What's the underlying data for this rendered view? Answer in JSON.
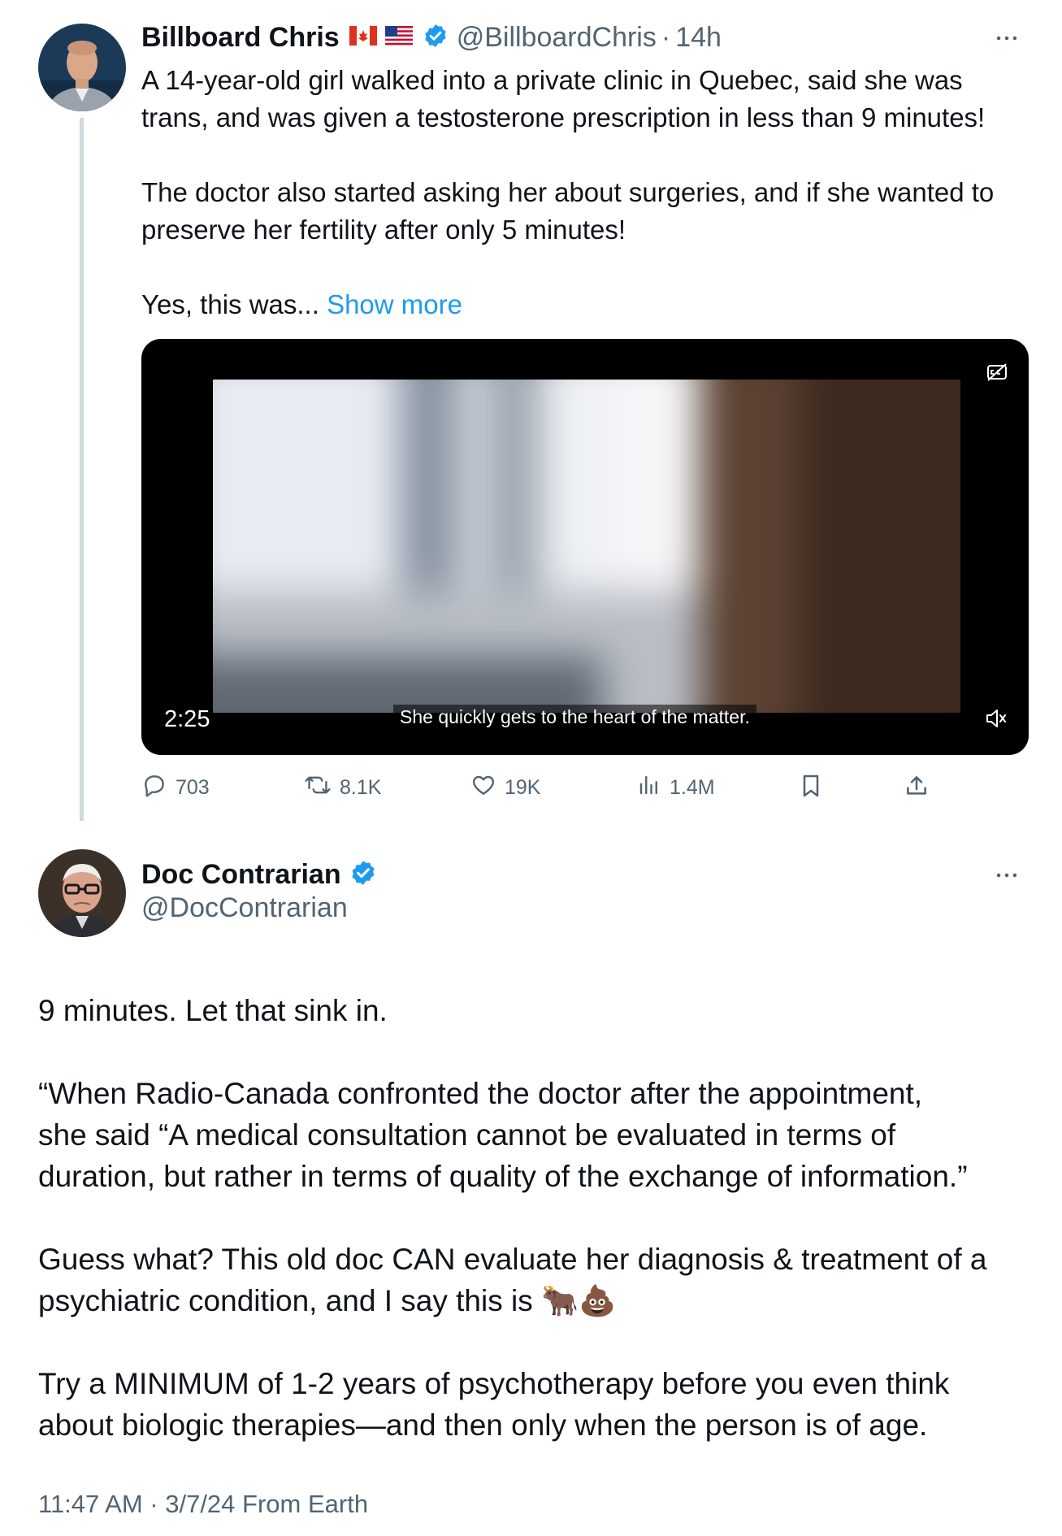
{
  "tweet1": {
    "author_name": "Billboard Chris",
    "flags": [
      "CA",
      "US"
    ],
    "handle": "@BillboardChris",
    "separator": "·",
    "time": "14h",
    "more_icon": "more-horizontal-icon",
    "text_lines": [
      [
        "A 14-year-old girl walked into a private clinic in Quebec, said she was",
        "trans, and was given a testosterone prescription in less than 9 minutes!"
      ],
      [
        "The doctor also started asking her about surgeries, and if she wanted to",
        "preserve her fertility after only 5 minutes!"
      ]
    ],
    "truncated_text": "Yes, this was...",
    "show_more": "Show more",
    "video": {
      "duration": "2:25",
      "caption": "She quickly gets to the heart of the matter.",
      "muted": true
    },
    "stats": {
      "replies": "703",
      "reposts": "8.1K",
      "likes": "19K",
      "views": "1.4M"
    },
    "colors": {
      "link": "#1d9bf0",
      "verified": "#1d9bf0",
      "muted_text": "#536471"
    }
  },
  "tweet2": {
    "author_name": "Doc Contrarian",
    "handle": "@DocContrarian",
    "paragraphs": [
      [
        "9 minutes. Let that sink in."
      ],
      [
        "“When Radio-Canada confronted the doctor after the appointment,",
        "she said “A medical consultation cannot be evaluated in terms of",
        "duration, but rather in terms of quality of the exchange of information.”"
      ],
      [
        "Guess what? This old doc CAN evaluate her diagnosis & treatment of a",
        "psychiatric condition, and I say this is 🐂💩"
      ],
      [
        "Try a MINIMUM of 1-2 years of psychotherapy before you even think",
        "about biologic therapies—and then only when the person is of age."
      ]
    ],
    "timestamp": "11:47 AM · 3/7/24 From Earth"
  }
}
